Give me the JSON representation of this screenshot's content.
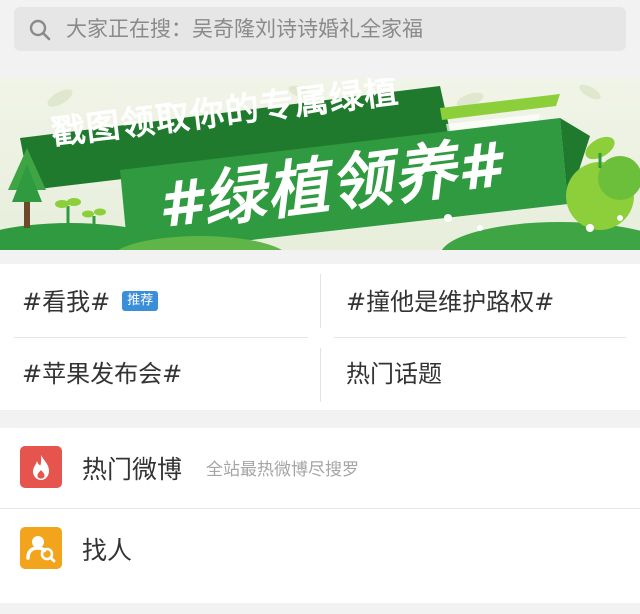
{
  "search": {
    "placeholder": "大家正在搜：吴奇隆刘诗诗婚礼全家福",
    "icon": "search-icon"
  },
  "banner": {
    "line1": "戳图领取你的专属绿植",
    "line2": "#绿植领养#",
    "colors": {
      "green": "#2f9a3f",
      "dark_green": "#1f7a2e",
      "light_green": "#8ccf3a"
    }
  },
  "topics": [
    {
      "label": "#看我#",
      "badge": "推荐"
    },
    {
      "label": "#撞他是维护路权#"
    },
    {
      "label": "#苹果发布会#"
    },
    {
      "label": "热门话题"
    }
  ],
  "list": [
    {
      "title": "热门微博",
      "subtitle": "全站最热微博尽搜罗",
      "icon": "flame-icon",
      "color": "#e5544d"
    },
    {
      "title": "找人",
      "icon": "find-person-icon",
      "color": "#f2a41c"
    }
  ]
}
